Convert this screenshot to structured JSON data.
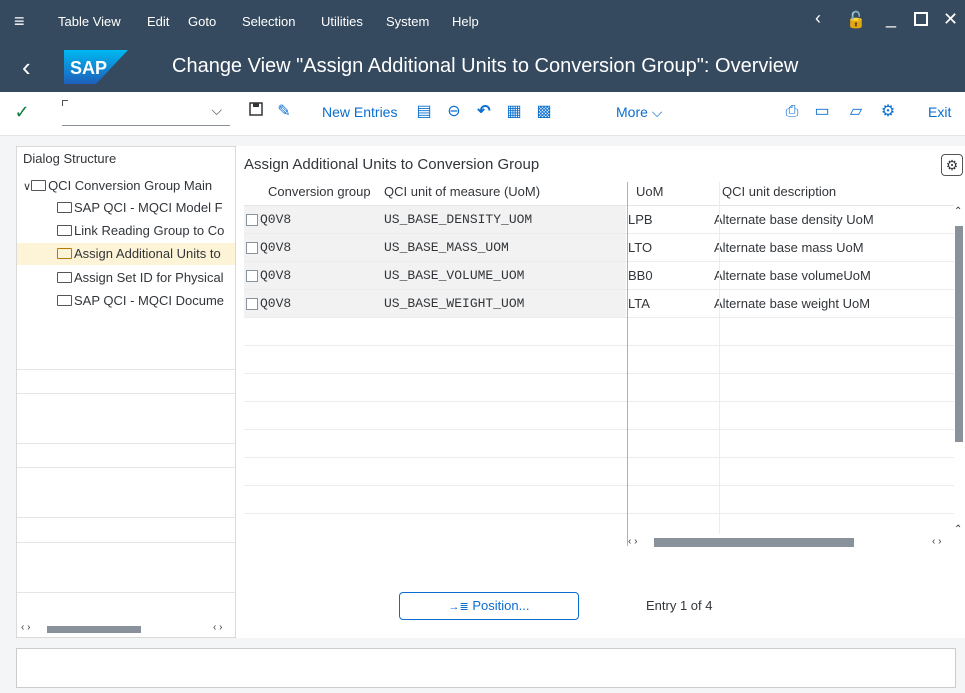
{
  "menu": {
    "items": [
      {
        "label": "Table View"
      },
      {
        "label": "Edit"
      },
      {
        "label": "Goto"
      },
      {
        "label": "Selection"
      },
      {
        "label": "Utilities"
      },
      {
        "label": "System"
      },
      {
        "label": "Help"
      }
    ]
  },
  "title": {
    "text": "Change View \"Assign Additional Units to Conversion Group\": Overview",
    "logo": "SAP"
  },
  "toolbar": {
    "command_field_value": "",
    "new_entries_label": "New Entries",
    "more_label": "More",
    "exit_label": "Exit"
  },
  "dialog_structure": {
    "title": "Dialog Structure",
    "items": [
      {
        "label": "QCI Conversion Group Main"
      },
      {
        "label": "SAP QCI - MQCI Model F"
      },
      {
        "label": "Link Reading Group to Co"
      },
      {
        "label": "Assign Additional Units to"
      },
      {
        "label": "Assign Set ID for Physical"
      },
      {
        "label": "SAP QCI - MQCI Docume"
      }
    ]
  },
  "table": {
    "title": "Assign Additional Units to Conversion Group",
    "columns": [
      "Conversion group",
      "QCI unit of measure (UoM)",
      "UoM",
      "QCI unit description"
    ],
    "rows": [
      {
        "group": "Q0V8",
        "qci_uom": "US_BASE_DENSITY_UOM",
        "uom": "LPB",
        "desc": "Alternate base density UoM"
      },
      {
        "group": "Q0V8",
        "qci_uom": "US_BASE_MASS_UOM",
        "uom": "LTO",
        "desc": "Alternate base mass UoM"
      },
      {
        "group": "Q0V8",
        "qci_uom": "US_BASE_VOLUME_UOM",
        "uom": "BB0",
        "desc": "Alternate base volumeUoM"
      },
      {
        "group": "Q0V8",
        "qci_uom": "US_BASE_WEIGHT_UOM",
        "uom": "LTA",
        "desc": "Alternate base weight UoM"
      }
    ]
  },
  "position_button": "Position...",
  "entry_info": "Entry 1 of 4",
  "colors": {
    "shell": "#354a5f",
    "accent": "#0a6ed1",
    "selected": "#fdf3d6"
  }
}
